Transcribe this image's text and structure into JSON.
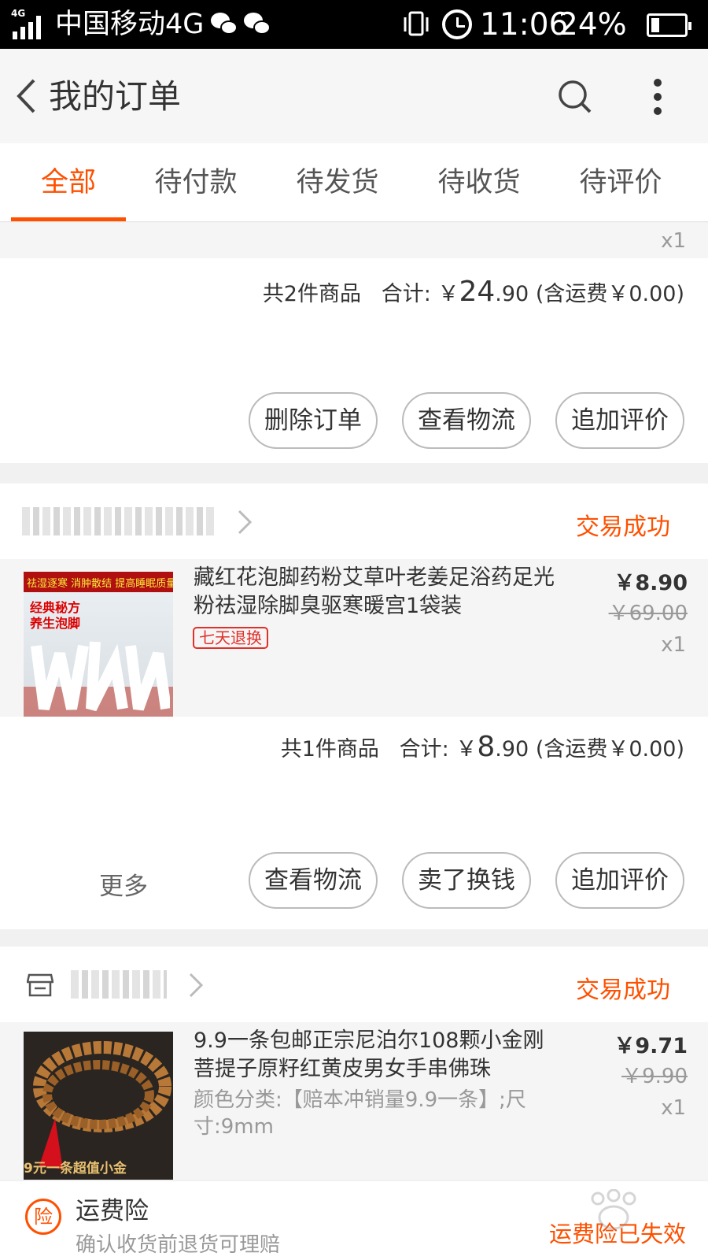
{
  "status_bar": {
    "network": "4G",
    "carrier": "中国移动4G",
    "time": "11:06",
    "battery": "24%",
    "battery_level": 0.24
  },
  "header": {
    "title": "我的订单"
  },
  "tabs": [
    {
      "label": "全部",
      "active": true
    },
    {
      "label": "待付款",
      "active": false
    },
    {
      "label": "待发货",
      "active": false
    },
    {
      "label": "待收货",
      "active": false
    },
    {
      "label": "待评价",
      "active": false
    }
  ],
  "colors": {
    "accent": "#ff5000",
    "tag_red": "#e0302a"
  },
  "orders": [
    {
      "qty": "x1",
      "summary": {
        "count": "共2件商品",
        "total_label": "合计:",
        "currency": "￥",
        "total_int": "24",
        "total_dec": ".90",
        "shipping": "(含运费￥0.00)"
      },
      "actions": [
        "删除订单",
        "查看物流",
        "追加评价"
      ]
    },
    {
      "status": "交易成功",
      "item": {
        "title": "藏红花泡脚药粉艾草叶老姜足浴药足光粉祛湿除脚臭驱寒暖宫1袋装",
        "tag": "七天退换",
        "price": "￥8.90",
        "orig_price": "￥69.00",
        "qty": "x1",
        "thumb_text": [
          "祛湿逐寒 消肿散结 提高睡眠质量",
          "经典秘方",
          "养生泡脚"
        ]
      },
      "summary": {
        "count": "共1件商品",
        "total_label": "合计:",
        "currency": "￥",
        "total_int": "8",
        "total_dec": ".90",
        "shipping": "(含运费￥0.00)"
      },
      "more": "更多",
      "actions": [
        "查看物流",
        "卖了换钱",
        "追加评价"
      ]
    },
    {
      "status": "交易成功",
      "item": {
        "title": "9.9一条包邮正宗尼泊尔108颗小金刚菩提子原籽红黄皮男女手串佛珠",
        "sku": "颜色分类:【赔本冲销量9.9一条】;尺寸:9mm",
        "price": "￥9.71",
        "orig_price": "￥9.90",
        "qty": "x1",
        "thumb_text": "9元一条超值小金"
      }
    }
  ],
  "insurance": {
    "icon_text": "险",
    "title": "运费险",
    "subtitle": "确认收货前退货可理赔",
    "status": "运费险已失效"
  }
}
